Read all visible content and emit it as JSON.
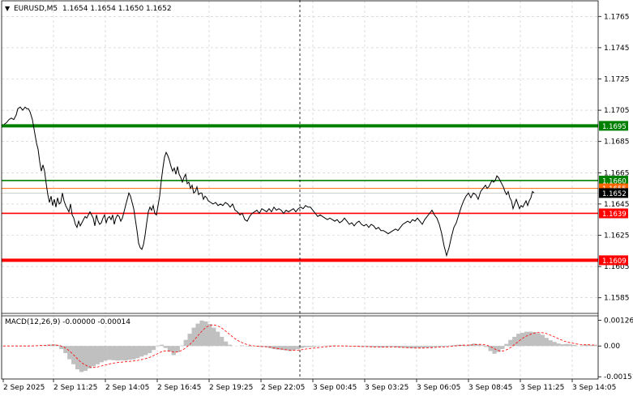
{
  "chart_data": {
    "type": "line",
    "symbol_header": {
      "arrow": "▼",
      "symbol": "EURUSD,M5",
      "ohlc": "1.1654 1.1654 1.1650 1.1652"
    },
    "price_panel": {
      "ylim": [
        1.1575,
        1.1775
      ],
      "y_ticks": [
        "1.1765",
        "1.1745",
        "1.1725",
        "1.1705",
        "1.1685",
        "1.1665",
        "1.1645",
        "1.1625",
        "1.1605",
        "1.1585"
      ],
      "grid": true,
      "levels": [
        {
          "value": 1.1695,
          "label": "1.1695",
          "color": "#008000",
          "thick": true
        },
        {
          "value": 1.166,
          "label": "1.1660",
          "color": "#008000",
          "thick": false
        },
        {
          "value": 1.1655,
          "label": "1.1655",
          "color": "#ff6600",
          "thick": false,
          "hidden_label": true
        },
        {
          "value": 1.1652,
          "label": "1.1652",
          "color": "#000000",
          "thick": false,
          "current": true
        },
        {
          "value": 1.1639,
          "label": "1.1639",
          "color": "#ff0000",
          "thick": false
        },
        {
          "value": 1.1609,
          "label": "1.1609",
          "color": "#ff0000",
          "thick": true
        }
      ],
      "series": [
        {
          "x": [
            0,
            3,
            6,
            9,
            12,
            15,
            17,
            20,
            23,
            26,
            28,
            30,
            32,
            35,
            38,
            40,
            42,
            44,
            46,
            48,
            50,
            52,
            54,
            56,
            58,
            60,
            62,
            64,
            66,
            68,
            70,
            72,
            74,
            76,
            78,
            80,
            82,
            84,
            86,
            88,
            90,
            92,
            94,
            96,
            98,
            100,
            102,
            104,
            106,
            108,
            110,
            112,
            114,
            116,
            118,
            120,
            122,
            124,
            126,
            128,
            130,
            132,
            134,
            136,
            138,
            140,
            142,
            144,
            146,
            148,
            150,
            152,
            154,
            156,
            158,
            160,
            162,
            164,
            166,
            168,
            170,
            172,
            174,
            176,
            178,
            180,
            182,
            184,
            186,
            188,
            190,
            192,
            194,
            196,
            198,
            200,
            202,
            204,
            206,
            208,
            210,
            212,
            214,
            216,
            218,
            220,
            222,
            224,
            226,
            228,
            230,
            232,
            234,
            236,
            238,
            240,
            242,
            244,
            246,
            248,
            250,
            252,
            255,
            258,
            261,
            264,
            267,
            270,
            273,
            276,
            279,
            282,
            285,
            288,
            291,
            294,
            297,
            300,
            303,
            306,
            309,
            312,
            315,
            318,
            321,
            324,
            327,
            330,
            333,
            336,
            339,
            342,
            345,
            348,
            351,
            354,
            357,
            360,
            363,
            366,
            369,
            372,
            375,
            378,
            381,
            384,
            387,
            390,
            393,
            396,
            399,
            402,
            405,
            408,
            411,
            414,
            417,
            420,
            423,
            426,
            429,
            432,
            435,
            438,
            441,
            444,
            447,
            450,
            453,
            456,
            459,
            462,
            465,
            468,
            471,
            474,
            477,
            480,
            483,
            486,
            489,
            492,
            495,
            498,
            501,
            504,
            507,
            510,
            513,
            516,
            519,
            522,
            525,
            528,
            531,
            534,
            537,
            540,
            543,
            546,
            549,
            552,
            555,
            558,
            561,
            564,
            567,
            570,
            573,
            576,
            579,
            582,
            585,
            588,
            591,
            594,
            596,
            598,
            600,
            602,
            604,
            606,
            608,
            610,
            612,
            614,
            616,
            618,
            620,
            622,
            624,
            626,
            628,
            630,
            632,
            634,
            636,
            638,
            640,
            642,
            644,
            646,
            648,
            650,
            652,
            654,
            656,
            658,
            660,
            662,
            664,
            666,
            668,
            670,
            672,
            674,
            676,
            678,
            680,
            682,
            684,
            686,
            688,
            690,
            692,
            694,
            696,
            698,
            700,
            702,
            704,
            706,
            708,
            710,
            712,
            714,
            716,
            718,
            720,
            722,
            724,
            726
          ],
          "values": [
            1.1696,
            1.1697,
            1.1699,
            1.17,
            1.1699,
            1.1702,
            1.1706,
            1.1707,
            1.1705,
            1.1707,
            1.1706,
            1.1706,
            1.1704,
            1.1699,
            1.169,
            1.1684,
            1.168,
            1.1672,
            1.1666,
            1.167,
            1.1666,
            1.1658,
            1.1651,
            1.1646,
            1.165,
            1.1644,
            1.1648,
            1.1643,
            1.1649,
            1.1645,
            1.1646,
            1.1652,
            1.1647,
            1.1644,
            1.1642,
            1.164,
            1.1645,
            1.1638,
            1.1636,
            1.1632,
            1.163,
            1.1634,
            1.1631,
            1.1633,
            1.1635,
            1.1637,
            1.1636,
            1.1638,
            1.164,
            1.1638,
            1.1636,
            1.1631,
            1.1638,
            1.1634,
            1.1632,
            1.1633,
            1.1636,
            1.1638,
            1.1633,
            1.1636,
            1.1637,
            1.1635,
            1.1638,
            1.1632,
            1.1636,
            1.1638,
            1.1637,
            1.1634,
            1.1636,
            1.164,
            1.1644,
            1.1648,
            1.1652,
            1.165,
            1.1646,
            1.1642,
            1.1635,
            1.1628,
            1.162,
            1.1617,
            1.1616,
            1.1619,
            1.1625,
            1.1633,
            1.164,
            1.1643,
            1.1641,
            1.1644,
            1.1639,
            1.1638,
            1.1644,
            1.165,
            1.166,
            1.1668,
            1.1675,
            1.1678,
            1.1676,
            1.1673,
            1.1669,
            1.1666,
            1.1668,
            1.1664,
            1.1669,
            1.1664,
            1.1662,
            1.1659,
            1.1662,
            1.1664,
            1.1658,
            1.1659,
            1.1655,
            1.1657,
            1.1652,
            1.1653,
            1.1656,
            1.1651,
            1.1652,
            1.1652,
            1.1648,
            1.165,
            1.1649,
            1.1647,
            1.1646,
            1.1645,
            1.1646,
            1.1644,
            1.1645,
            1.1644,
            1.1646,
            1.1645,
            1.1643,
            1.1645,
            1.1641,
            1.164,
            1.1638,
            1.1639,
            1.1635,
            1.1634,
            1.1637,
            1.1639,
            1.164,
            1.1641,
            1.1639,
            1.1642,
            1.1641,
            1.164,
            1.1642,
            1.164,
            1.1643,
            1.1641,
            1.1642,
            1.1641,
            1.1639,
            1.1641,
            1.164,
            1.1641,
            1.1642,
            1.164,
            1.1642,
            1.1643,
            1.1642,
            1.1644,
            1.1643,
            1.1643,
            1.1641,
            1.1639,
            1.1637,
            1.1638,
            1.1637,
            1.1636,
            1.1635,
            1.1636,
            1.1635,
            1.1634,
            1.1635,
            1.1633,
            1.1634,
            1.1636,
            1.1634,
            1.1632,
            1.1633,
            1.1631,
            1.1633,
            1.1634,
            1.1632,
            1.1631,
            1.1632,
            1.163,
            1.1632,
            1.1631,
            1.1629,
            1.163,
            1.1628,
            1.1628,
            1.1627,
            1.1626,
            1.1627,
            1.1628,
            1.1629,
            1.1628,
            1.163,
            1.1632,
            1.1633,
            1.1634,
            1.1633,
            1.1635,
            1.1634,
            1.1636,
            1.1634,
            1.1632,
            1.1635,
            1.1637,
            1.1639,
            1.1641,
            1.1638,
            1.1636,
            1.1632,
            1.1626,
            1.1618,
            1.1612,
            1.1617,
            1.1624,
            1.163,
            1.1633,
            1.1638,
            1.1643,
            1.1647,
            1.165,
            1.1652,
            1.1649,
            1.1652,
            1.1651,
            1.1648,
            1.1653,
            1.1655,
            1.1657,
            1.1655,
            1.1656,
            1.1658,
            1.166,
            1.1659,
            1.166,
            1.1663,
            1.1662,
            1.166,
            1.1658,
            1.1656,
            1.1653,
            1.1651,
            1.1653,
            1.1649,
            1.1647,
            1.1642,
            1.1645,
            1.1648,
            1.1645,
            1.1642,
            1.1644,
            1.1643,
            1.1645,
            1.1647,
            1.1644,
            1.1647,
            1.1649,
            1.1653,
            1.1652
          ]
        }
      ]
    },
    "macd_panel": {
      "label": "MACD(12,26,9) -0.00000 -0.00014",
      "ylim": [
        -0.00162,
        0.00148
      ],
      "y_ticks": [
        "0.00126",
        "0.00",
        "-0.00151"
      ],
      "y_tick_values": [
        0.00126,
        0.0,
        -0.00151
      ],
      "histogram": [
        0,
        0,
        0,
        0,
        0,
        0,
        0,
        0,
        0,
        0,
        3e-05,
        6e-05,
        8e-05,
        5e-05,
        -0.00015,
        -0.00035,
        -0.00065,
        -0.0009,
        -0.00115,
        -0.00128,
        -0.00122,
        -0.0011,
        -0.001,
        -0.0009,
        -0.0008,
        -0.00072,
        -0.00068,
        -0.0007,
        -0.00072,
        -0.0007,
        -0.00072,
        -0.00068,
        -0.00066,
        -0.0006,
        -0.00052,
        -0.00045,
        -0.00035,
        -0.0002,
        2e-05,
        6e-05,
        -0.0001,
        -0.00028,
        -0.00045,
        -0.0003,
        2e-05,
        0.0003,
        0.0006,
        0.0009,
        0.0011,
        0.00125,
        0.0012,
        0.00108,
        0.0009,
        0.0007,
        0.00045,
        0.00022,
        6e-05,
        0,
        0,
        3e-05,
        0,
        -3e-05,
        0,
        -3e-05,
        -5e-05,
        -4e-05,
        -0.0001,
        -0.00015,
        -0.00018,
        -0.0002,
        -0.00022,
        -0.00025,
        -0.0002,
        -0.00015,
        -0.0001,
        -6e-05,
        -5e-05,
        -4e-05,
        -2e-05,
        0,
        2e-05,
        2e-05,
        3e-05,
        1e-05,
        0,
        -1e-05,
        0,
        -2e-05,
        -3e-05,
        -4e-05,
        -3e-05,
        -5e-05,
        -6e-05,
        -5e-05,
        -7e-05,
        -6e-05,
        -4e-05,
        -5e-05,
        -7e-05,
        -8e-05,
        -9e-05,
        -0.0001,
        -0.00011,
        -0.0001,
        -9e-05,
        -8e-05,
        -7e-05,
        -6e-05,
        -5e-05,
        -4e-05,
        -3e-05,
        2e-05,
        4e-05,
        6e-05,
        6e-05,
        3e-05,
        8e-05,
        0.00012,
        8e-05,
        4e-05,
        -5e-05,
        -0.00025,
        -0.00038,
        -0.0003,
        -0.00015,
        0.0001,
        0.0003,
        0.00045,
        0.0006,
        0.00065,
        0.0007,
        0.0007,
        0.00068,
        0.00062,
        0.00055,
        0.0004,
        0.00028,
        0.0002,
        0.00012,
        8e-05,
        0.0001,
        8e-05,
        5e-05,
        0,
        4e-05,
        6e-05,
        4e-05,
        5e-05
      ],
      "signal": [
        0,
        0,
        0,
        0,
        0,
        0,
        0,
        0,
        1e-05,
        2e-05,
        3e-05,
        4e-05,
        5e-05,
        5e-05,
        2e-05,
        -5e-05,
        -0.00018,
        -0.00035,
        -0.00055,
        -0.00075,
        -0.0009,
        -0.001,
        -0.00105,
        -0.00105,
        -0.001,
        -0.00095,
        -0.0009,
        -0.00085,
        -0.00082,
        -0.0008,
        -0.00078,
        -0.00076,
        -0.00074,
        -0.00072,
        -0.00068,
        -0.00064,
        -0.00058,
        -0.0005,
        -0.0004,
        -0.0003,
        -0.00024,
        -0.00024,
        -0.00028,
        -0.0003,
        -0.00024,
        -0.00012,
        4e-05,
        0.00022,
        0.00045,
        0.00068,
        0.00088,
        0.001,
        0.00104,
        0.001,
        0.0009,
        0.00075,
        0.00058,
        0.00042,
        0.00028,
        0.00018,
        0.0001,
        4e-05,
        1e-05,
        -1e-05,
        -3e-05,
        -4e-05,
        -6e-05,
        -9e-05,
        -0.00012,
        -0.00015,
        -0.00018,
        -0.0002,
        -0.00021,
        -0.0002,
        -0.00018,
        -0.00015,
        -0.00012,
        -0.0001,
        -8e-05,
        -6e-05,
        -4e-05,
        -2e-05,
        0,
        0,
        0,
        0,
        -1e-05,
        -1e-05,
        -2e-05,
        -3e-05,
        -3e-05,
        -4e-05,
        -5e-05,
        -5e-05,
        -6e-05,
        -6e-05,
        -5e-05,
        -5e-05,
        -6e-05,
        -7e-05,
        -8e-05,
        -9e-05,
        -0.0001,
        -0.0001,
        -0.0001,
        -9e-05,
        -8e-05,
        -7e-05,
        -6e-05,
        -5e-05,
        -4e-05,
        -2e-05,
        0,
        2e-05,
        4e-05,
        4e-05,
        5e-05,
        7e-05,
        8e-05,
        7e-05,
        3e-05,
        -6e-05,
        -0.00017,
        -0.00024,
        -0.00024,
        -0.00016,
        -4e-05,
        0.00012,
        0.00028,
        0.00042,
        0.00052,
        0.0006,
        0.00065,
        0.00066,
        0.00064,
        0.00058,
        0.0005,
        0.00041,
        0.00032,
        0.00024,
        0.00018,
        0.00014,
        0.0001,
        7e-05,
        6e-05,
        6e-05,
        5e-05,
        5e-05
      ]
    },
    "x_tick_labels": [
      "2 Sep 2025",
      "2 Sep 11:25",
      "2 Sep 14:05",
      "2 Sep 16:45",
      "2 Sep 19:25",
      "2 Sep 22:05",
      "3 Sep 00:45",
      "3 Sep 03:25",
      "3 Sep 06:05",
      "3 Sep 08:45",
      "3 Sep 11:25",
      "3 Sep 14:05"
    ],
    "colors": {
      "price_line": "#000000",
      "grid": "#c8c8c8",
      "histogram": "#c0c0c0",
      "signal": "#ff0000",
      "resistance": "#008000",
      "support": "#ff0000",
      "orange_level": "#ff6600"
    }
  }
}
